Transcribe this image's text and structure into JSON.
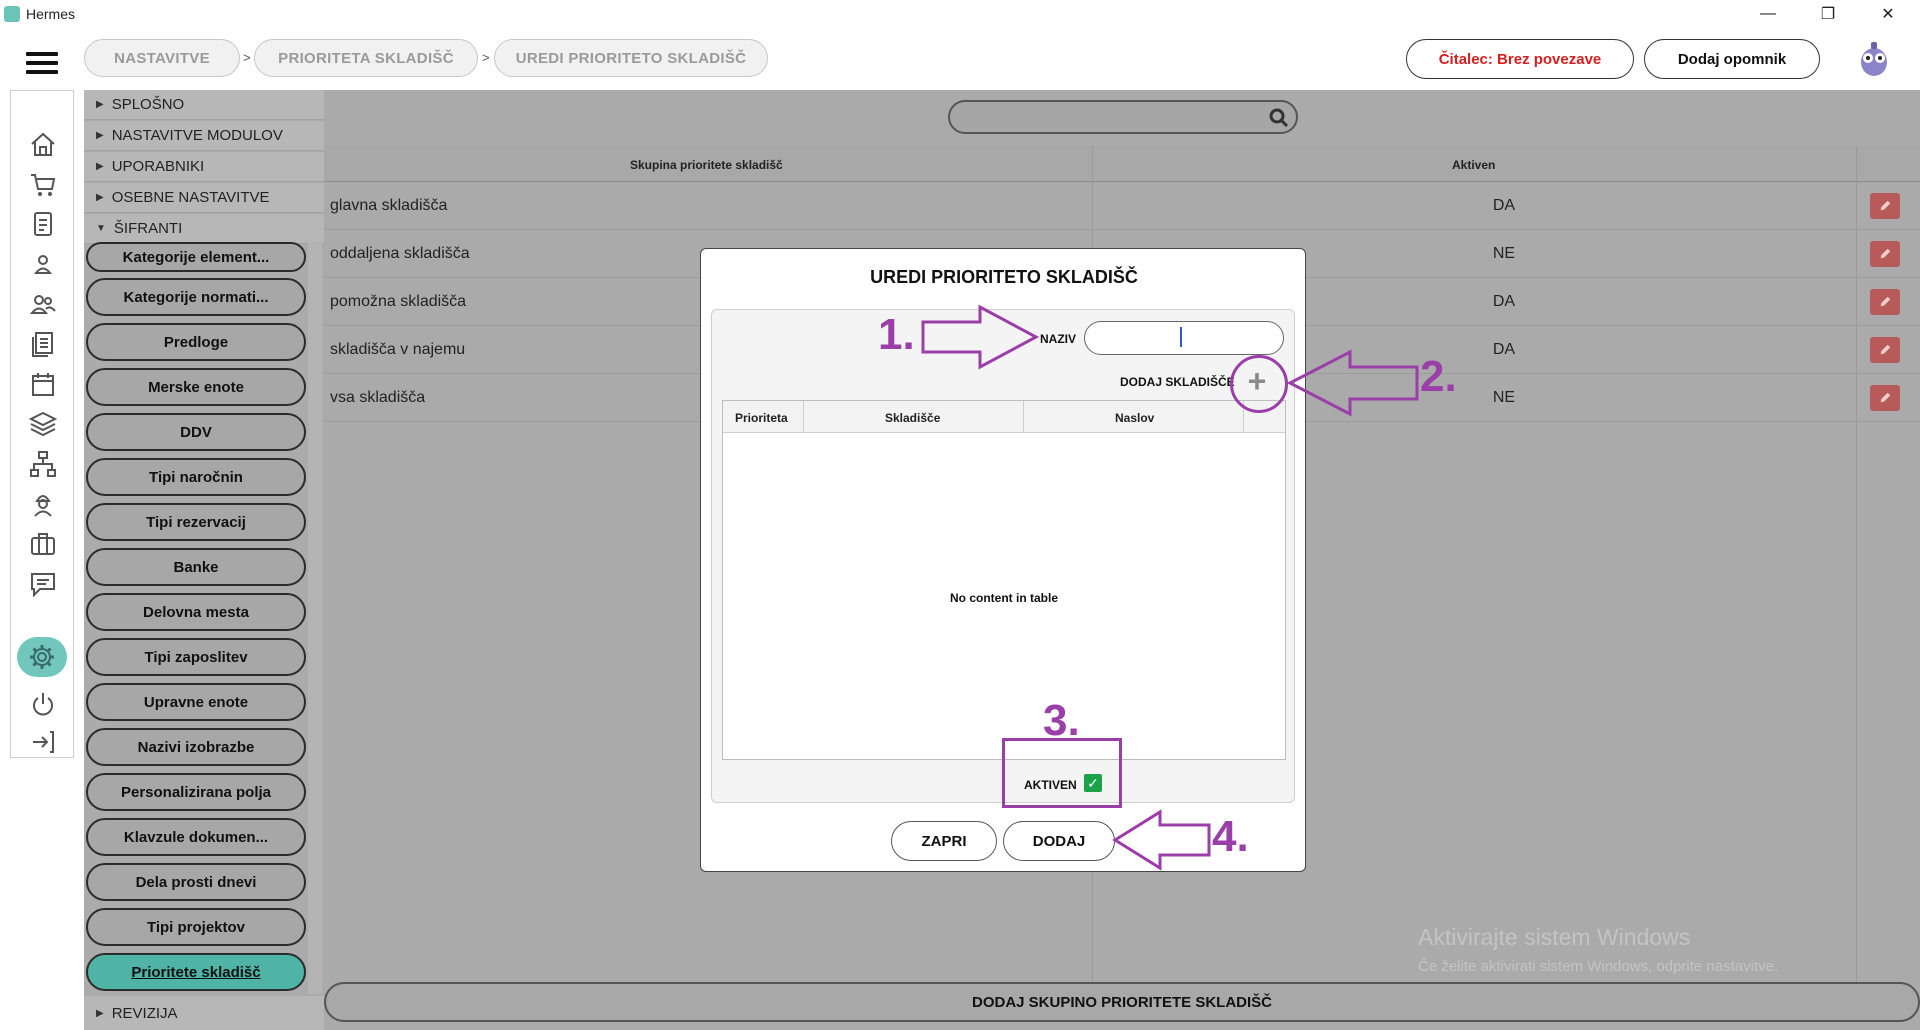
{
  "window": {
    "title": "Hermes",
    "minimize": "—",
    "restore": "❐",
    "close": "✕"
  },
  "breadcrumb": [
    "NASTAVITVE",
    "PRIORITETA SKLADIŠČ",
    "UREDI PRIORITETO SKLADIŠČ"
  ],
  "breadcrumb_sep": ">",
  "header": {
    "reader_status": "Čitalec: Brez povezave",
    "reader_status_color": "#d81e1e",
    "add_reminder": "Dodaj opomnik"
  },
  "rail_icons": [
    "home-icon",
    "cart-icon",
    "document-icon",
    "user-icon",
    "users-icon",
    "list-icon",
    "calendar-icon",
    "layers-icon",
    "hierarchy-icon",
    "worker-icon",
    "briefcase-icon",
    "chat-icon",
    "gear-icon",
    "power-icon",
    "logout-icon"
  ],
  "panel": {
    "sections": [
      "SPLOŠNO",
      "NASTAVITVE MODULOV",
      "UPORABNIKI",
      "OSEBNE NASTAVITVE",
      "ŠIFRANTI"
    ],
    "items": [
      "Kategorije element...",
      "Kategorije normati...",
      "Predloge",
      "Merske enote",
      "DDV",
      "Tipi naročnin",
      "Tipi rezervacij",
      "Banke",
      "Delovna mesta",
      "Tipi zaposlitev",
      "Upravne enote",
      "Nazivi izobrazbe",
      "Personalizirana polja",
      "Klavzule dokumen...",
      "Dela prosti dnevi",
      "Tipi projektov",
      "Prioritete skladišč"
    ],
    "active_item": "Prioritete skladišč",
    "footer_section": "REVIZIJA",
    "active_color": "#4fb4a6"
  },
  "main": {
    "search_placeholder": "",
    "columns": [
      "Skupina prioritete skladišč",
      "Aktiven"
    ],
    "rows": [
      {
        "name": "glavna skladišča",
        "active": "DA"
      },
      {
        "name": "oddaljena skladišča",
        "active": "NE"
      },
      {
        "name": "pomožna skladišča",
        "active": "DA"
      },
      {
        "name": "skladišča v najemu",
        "active": "DA"
      },
      {
        "name": "vsa skladišča",
        "active": "NE"
      }
    ],
    "add_group_button": "DODAJ SKUPINO PRIORITETE SKLADIŠČ",
    "watermark_title": "Aktivirajte sistem Windows",
    "watermark_sub": "Če želite aktivirati sistem Windows, odprite nastavitve."
  },
  "modal": {
    "title": "UREDI PRIORITETO SKLADIŠČ",
    "naziv_label": "NAZIV",
    "naziv_value": "",
    "add_warehouse_label": "DODAJ SKLADIŠČE",
    "table_columns": [
      "Prioriteta",
      "Skladišče",
      "Naslov"
    ],
    "empty_text": "No content in table",
    "aktiven_label": "AKTIVEN",
    "aktiven_checked": true,
    "close_button": "ZAPRI",
    "add_button": "DODAJ"
  },
  "annotations": {
    "color": "#9b3fa8",
    "labels": [
      "1.",
      "2.",
      "3.",
      "4."
    ]
  }
}
